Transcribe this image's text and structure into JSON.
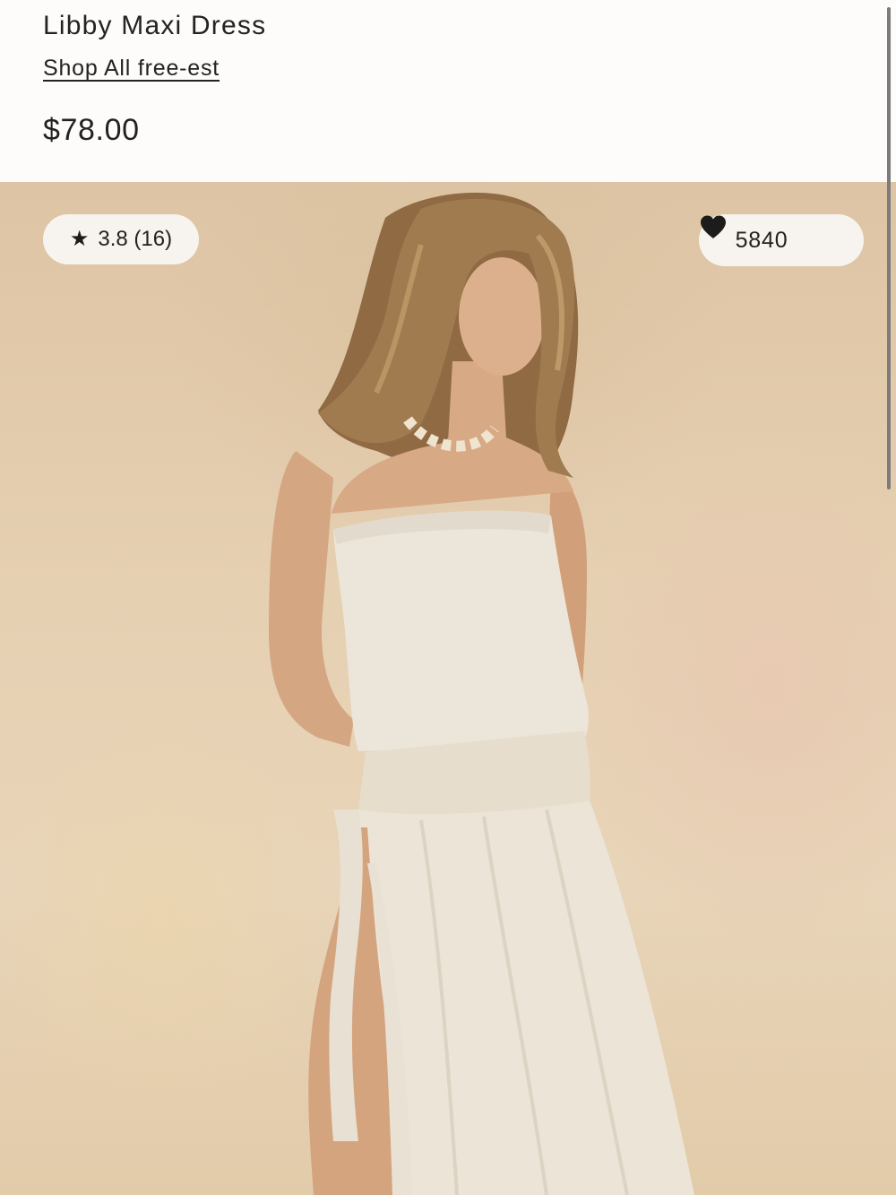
{
  "product": {
    "title": "Libby Maxi Dress",
    "shop_link": "Shop All free-est",
    "price": "$78.00"
  },
  "image": {
    "rating": {
      "icon": "star-icon",
      "text": "3.8 (16)"
    },
    "likes": {
      "count": "5840",
      "icon": "heart-icon"
    }
  },
  "colors": {
    "background": "#fefcfb",
    "pill": "#f7f3ee",
    "text": "#222222",
    "backdrop": "#e6d0b2",
    "dress": "#ece5d9"
  }
}
